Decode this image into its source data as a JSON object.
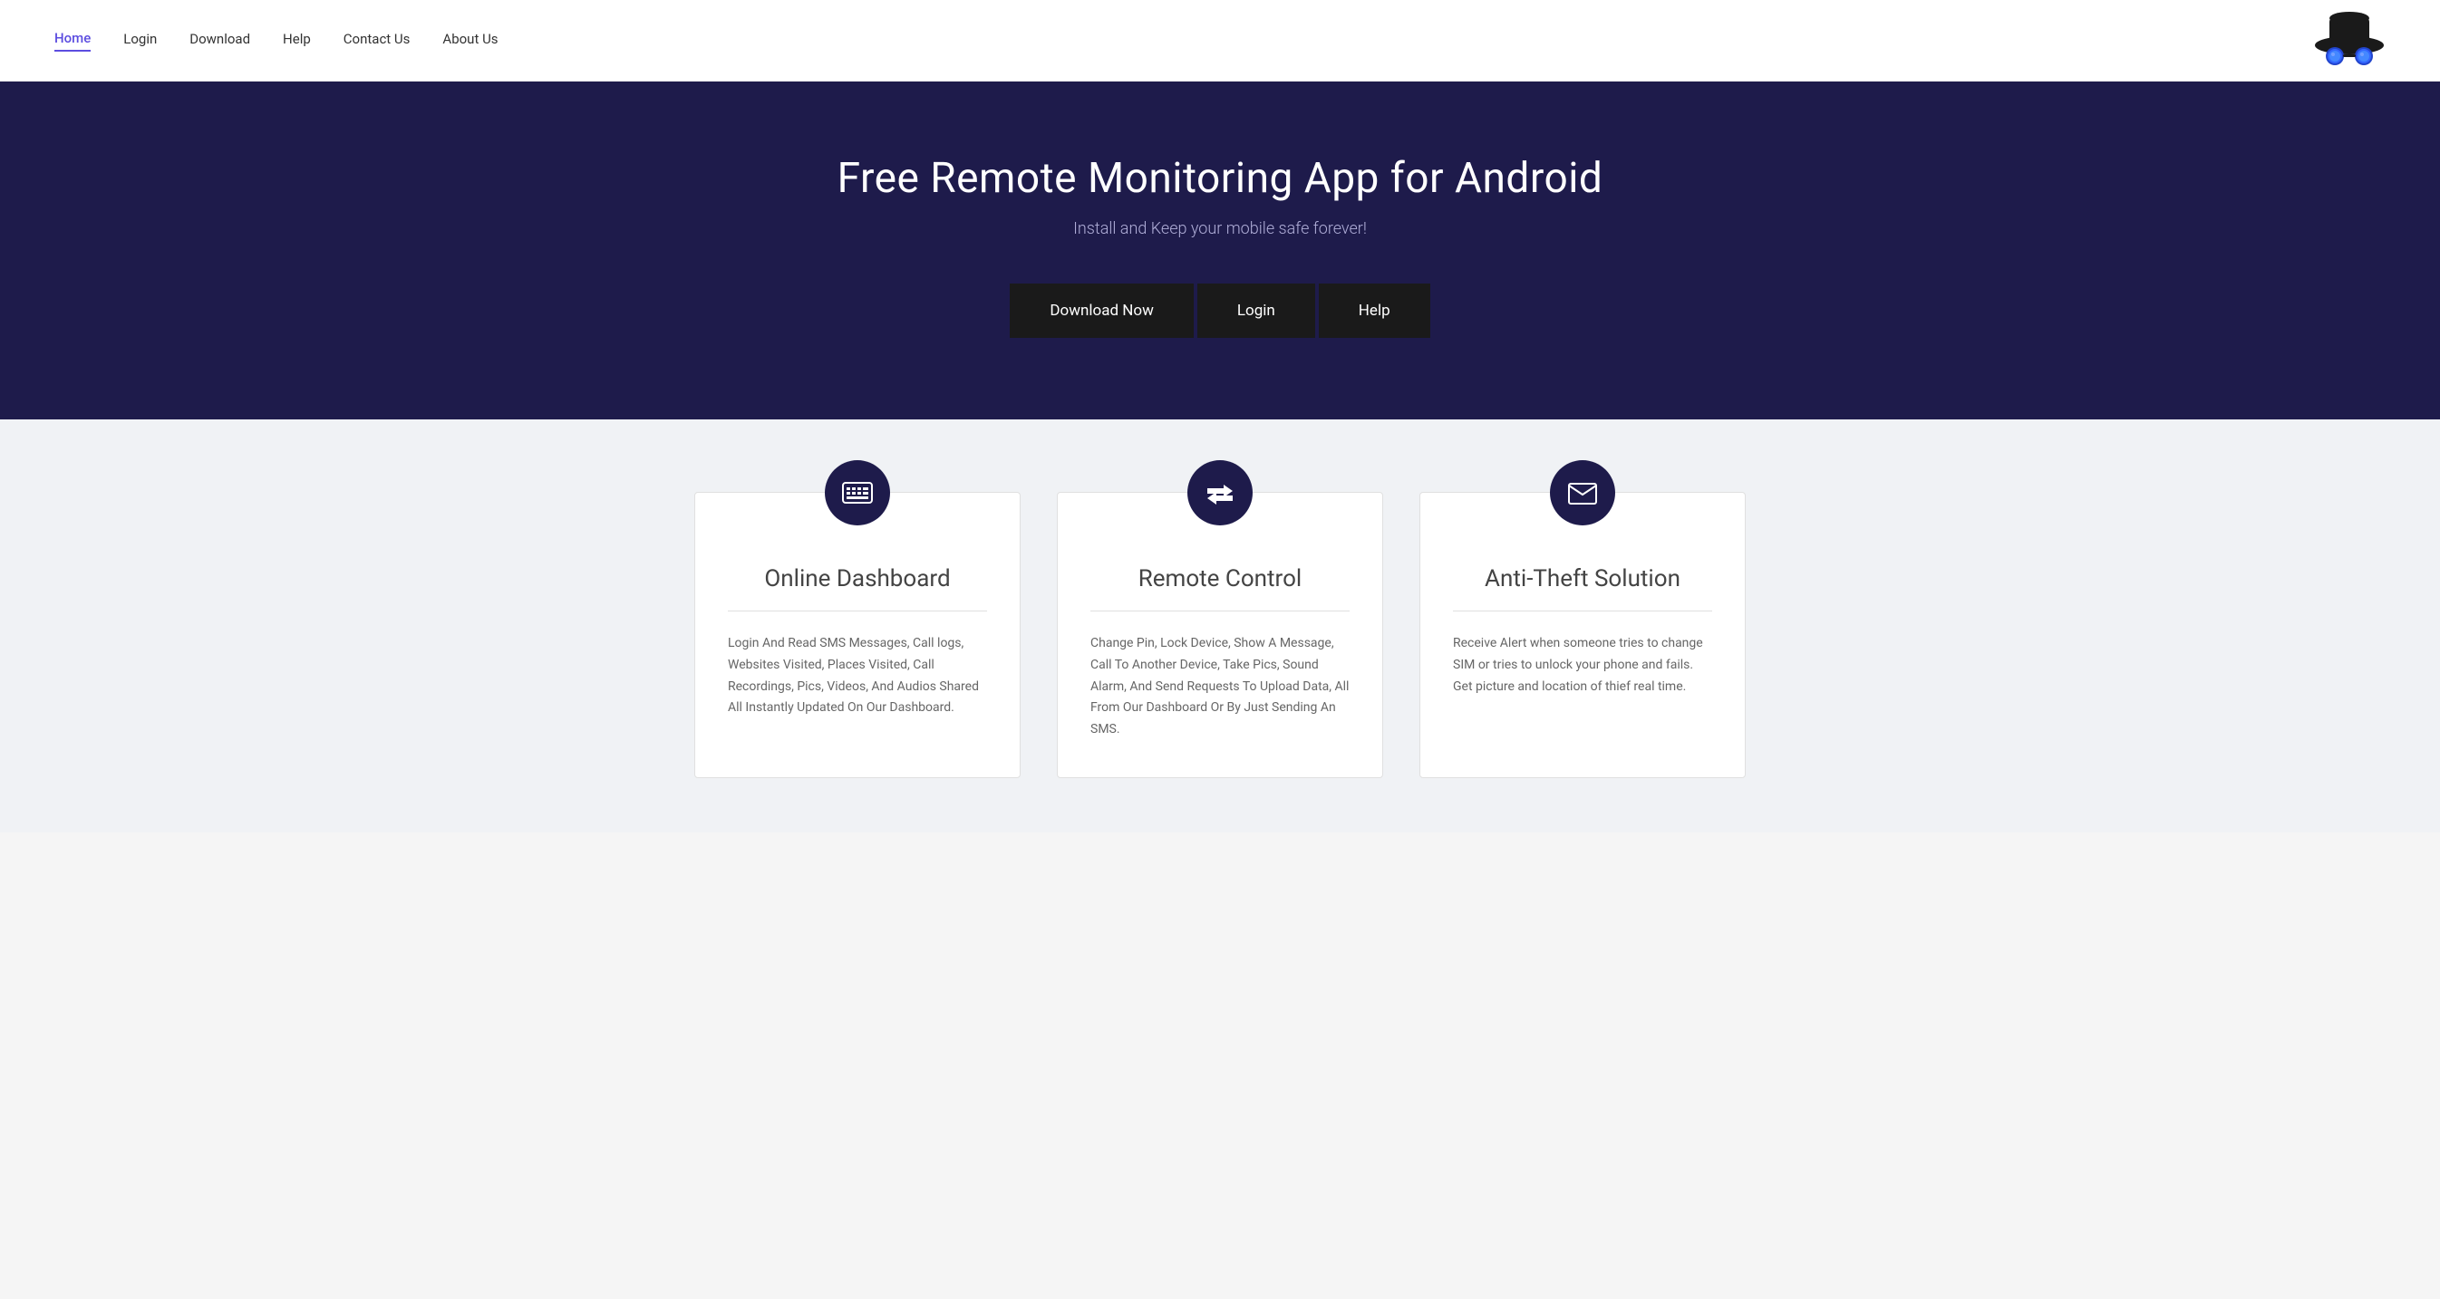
{
  "header": {
    "nav": [
      {
        "label": "Home",
        "active": true,
        "id": "home"
      },
      {
        "label": "Login",
        "active": false,
        "id": "login"
      },
      {
        "label": "Download",
        "active": false,
        "id": "download"
      },
      {
        "label": "Help",
        "active": false,
        "id": "help"
      },
      {
        "label": "Contact Us",
        "active": false,
        "id": "contact"
      },
      {
        "label": "About Us",
        "active": false,
        "id": "about"
      }
    ]
  },
  "hero": {
    "title": "Free Remote Monitoring App for Android",
    "subtitle": "Install and Keep your mobile safe forever!",
    "buttons": [
      {
        "label": "Download Now",
        "id": "download-now"
      },
      {
        "label": "Login",
        "id": "login"
      },
      {
        "label": "Help",
        "id": "help"
      }
    ]
  },
  "features": [
    {
      "id": "online-dashboard",
      "icon": "keyboard",
      "title": "Online Dashboard",
      "description": "Login And Read SMS Messages, Call logs, Websites Visited, Places Visited, Call Recordings, Pics, Videos, And Audios Shared All Instantly Updated On Our Dashboard."
    },
    {
      "id": "remote-control",
      "icon": "arrows",
      "title": "Remote Control",
      "description": "Change Pin, Lock Device, Show A Message, Call To Another Device, Take Pics, Sound Alarm, And Send Requests To Upload Data, All From Our Dashboard Or By Just Sending An SMS."
    },
    {
      "id": "anti-theft",
      "icon": "envelope",
      "title": "Anti-Theft Solution",
      "description": "Receive Alert when someone tries to change SIM or tries to unlock your phone and fails. Get picture and location of thief real time."
    }
  ]
}
